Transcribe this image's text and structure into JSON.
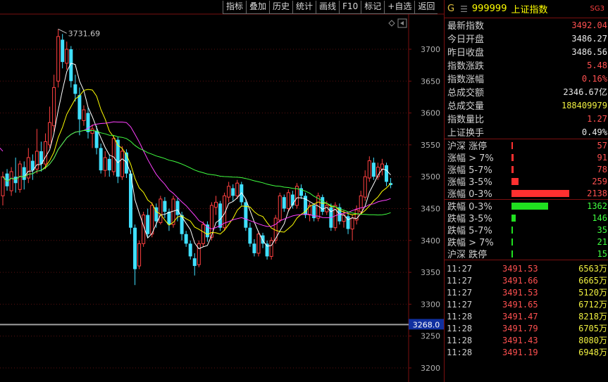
{
  "toolbar": [
    "指标",
    "叠加",
    "历史",
    "统计",
    "画线",
    "F10",
    "标记",
    "+自选",
    "返回"
  ],
  "chart": {
    "y_ticks": [
      "3700",
      "3650",
      "3600",
      "3550",
      "3500",
      "3450",
      "3400",
      "3350",
      "3300",
      "3250",
      "3200"
    ],
    "high_label": "3731.69",
    "cursor_label": "3268.0",
    "colors": {
      "up": "#ff4040",
      "down": "#40e0ff",
      "ma1": "#ffffff",
      "ma2": "#ffff00",
      "ma3": "#ff40ff",
      "ma4": "#40ff40"
    }
  },
  "panel": {
    "header": {
      "market": "G",
      "menu_icon": "menu-icon",
      "code": "999999",
      "name": "上证指数",
      "badge": "SG3"
    },
    "quote": [
      {
        "label": "最新指数",
        "value": "3492.04",
        "color": "red"
      },
      {
        "label": "今日开盘",
        "value": "3486.27",
        "color": "white"
      },
      {
        "label": "昨日收盘",
        "value": "3486.56",
        "color": "white"
      },
      {
        "label": "指数涨跌",
        "value": "5.48",
        "color": "red"
      },
      {
        "label": "指数涨幅",
        "value": "0.16%",
        "color": "red"
      },
      {
        "label": "总成交额",
        "value": "2346.67亿",
        "color": "white"
      },
      {
        "label": "总成交量",
        "value": "188409979",
        "color": "yellow"
      },
      {
        "label": "指数量比",
        "value": "1.27",
        "color": "red"
      },
      {
        "label": "上证换手",
        "value": "0.49%",
        "color": "white"
      }
    ],
    "up_stats": [
      {
        "label": "沪深 涨停",
        "value": "57",
        "ratio": 0.026
      },
      {
        "label": "涨幅 > 7%",
        "value": "91",
        "ratio": 0.04
      },
      {
        "label": "涨幅 5-7%",
        "value": "78",
        "ratio": 0.036
      },
      {
        "label": "涨幅 3-5%",
        "value": "259",
        "ratio": 0.121
      },
      {
        "label": "涨幅 0-3%",
        "value": "2138",
        "ratio": 1.0
      }
    ],
    "down_stats": [
      {
        "label": "跌幅 0-3%",
        "value": "1362",
        "ratio": 0.637
      },
      {
        "label": "跌幅 3-5%",
        "value": "146",
        "ratio": 0.068
      },
      {
        "label": "跌幅 5-7%",
        "value": "35",
        "ratio": 0.016
      },
      {
        "label": "跌幅 > 7%",
        "value": "21",
        "ratio": 0.01
      },
      {
        "label": "沪深 跌停",
        "value": "15",
        "ratio": 0.007
      }
    ],
    "ticks": [
      {
        "time": "11:27",
        "price": "3491.53",
        "vol": "6563万"
      },
      {
        "time": "11:27",
        "price": "3491.66",
        "vol": "6665万"
      },
      {
        "time": "11:27",
        "price": "3491.53",
        "vol": "5120万"
      },
      {
        "time": "11:27",
        "price": "3491.65",
        "vol": "6712万"
      },
      {
        "time": "11:28",
        "price": "3491.47",
        "vol": "8218万"
      },
      {
        "time": "11:28",
        "price": "3491.79",
        "vol": "6705万"
      },
      {
        "time": "11:28",
        "price": "3491.43",
        "vol": "8080万"
      },
      {
        "time": "11:28",
        "price": "3491.19",
        "vol": "6948万"
      }
    ]
  }
}
